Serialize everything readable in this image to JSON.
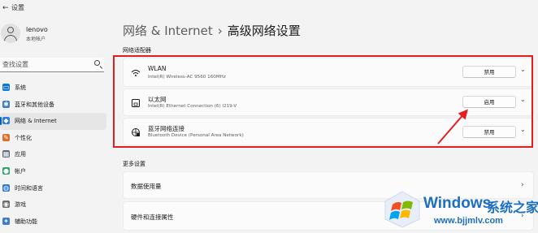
{
  "window": {
    "title": "设置",
    "back_glyph": "←"
  },
  "profile": {
    "name": "lenovo",
    "account_type": "本地帐户"
  },
  "search": {
    "placeholder": "查找设置"
  },
  "sidebar": {
    "items": [
      {
        "label": "系统",
        "icon": "monitor-icon",
        "color": "#0f78d4",
        "glyph": "▭"
      },
      {
        "label": "蓝牙和其他设备",
        "icon": "bluetooth-devices-icon",
        "color": "#3a7ad1",
        "glyph": "✱"
      },
      {
        "label": "网络 & Internet",
        "icon": "network-icon",
        "color": "#2c7fd6",
        "glyph": "◆",
        "active": true
      },
      {
        "label": "个性化",
        "icon": "brush-icon",
        "color": "#e06c2a",
        "glyph": "✎"
      },
      {
        "label": "应用",
        "icon": "apps-icon",
        "color": "#5c6b7a",
        "glyph": "▦"
      },
      {
        "label": "帐户",
        "icon": "account-icon",
        "color": "#2ea36c",
        "glyph": "●"
      },
      {
        "label": "时间和语言",
        "icon": "globe-clock-icon",
        "color": "#2a7bd5",
        "glyph": "◍"
      },
      {
        "label": "游戏",
        "icon": "controller-icon",
        "color": "#6b6b6b",
        "glyph": "◉"
      },
      {
        "label": "辅助功能",
        "icon": "accessibility-icon",
        "color": "#3a7ad1",
        "glyph": "✦"
      }
    ]
  },
  "header": {
    "root": "网络 & Internet",
    "separator": "›",
    "current": "高级网络设置"
  },
  "sections": {
    "adapters_label": "网络适配器",
    "more_label": "更多设置"
  },
  "adapters": [
    {
      "name": "WLAN",
      "detail": "Intel(R) Wireless-AC 9560 160MHz",
      "button": "禁用",
      "icon": "wifi-icon"
    },
    {
      "name": "以太网",
      "detail": "Intel(R) Ethernet Connection (6) I219-V",
      "button": "启用",
      "icon": "ethernet-icon"
    },
    {
      "name": "蓝牙网络连接",
      "detail": "Bluetooth Device (Personal Area Network)",
      "button": "禁用",
      "icon": "bluetooth-network-icon"
    }
  ],
  "more": [
    {
      "name": "数据使用量"
    },
    {
      "name": "硬件和连接属性"
    }
  ],
  "chevrons": {
    "down": "⌄",
    "right": "›"
  },
  "watermark": {
    "brand": "Windows",
    "brand_cn": "系统之家",
    "url": "www.bjjmlv.com"
  },
  "colors": {
    "accent": "#005fb8",
    "annotation": "#e21e1e",
    "watermark": "#1d6fc0"
  }
}
